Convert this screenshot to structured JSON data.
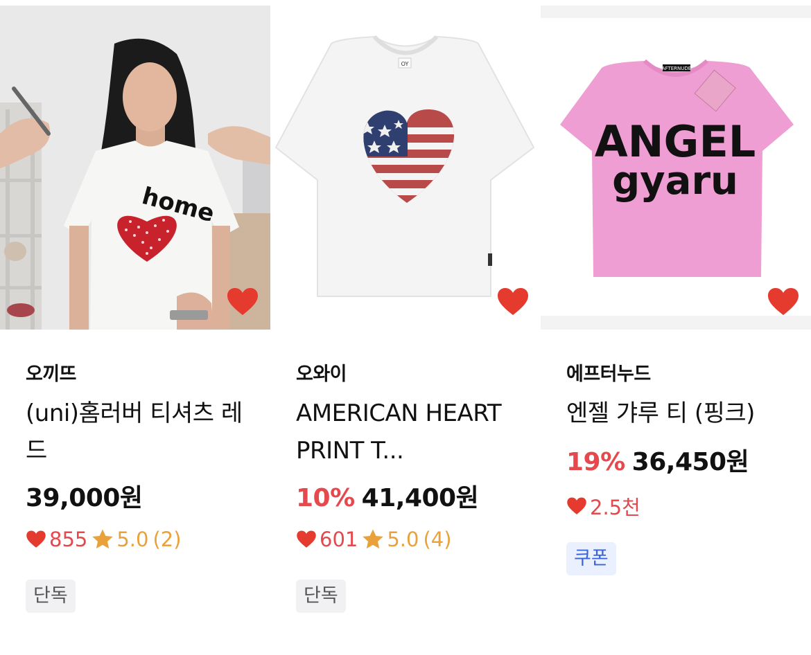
{
  "products": [
    {
      "brand": "오끼뜨",
      "name": "(uni)홈러버 티셔츠 레드",
      "discount": "",
      "price": "39,000원",
      "likes": "855",
      "rating": "5.0",
      "review_count": "(2)",
      "badge": "단독",
      "image_icon": "model-wearing-white-tee-with-red-dotted-heart-photo",
      "print_text": "home"
    },
    {
      "brand": "오와이",
      "name": "AMERICAN HEART PRINT T...",
      "discount": "10%",
      "price": "41,400원",
      "likes": "601",
      "rating": "5.0",
      "review_count": "(4)",
      "badge": "단독",
      "image_icon": "white-tee-with-american-flag-heart-photo",
      "label_text": "OY"
    },
    {
      "brand": "에프터누드",
      "name": "엔젤 갸루 티 (핑크)",
      "discount": "19%",
      "price": "36,450원",
      "likes": "2.5천",
      "badge": "쿠폰",
      "image_icon": "pink-tee-angel-gyaru-print-photo",
      "print_line1": "ANGEL",
      "print_line2": "gyaru",
      "tag_text": "AFTERNUDE"
    }
  ],
  "colors": {
    "accent_red": "#e5484d",
    "heart_red": "#e53b2f",
    "star": "#e9a23b",
    "coupon_blue": "#3a63d8"
  }
}
